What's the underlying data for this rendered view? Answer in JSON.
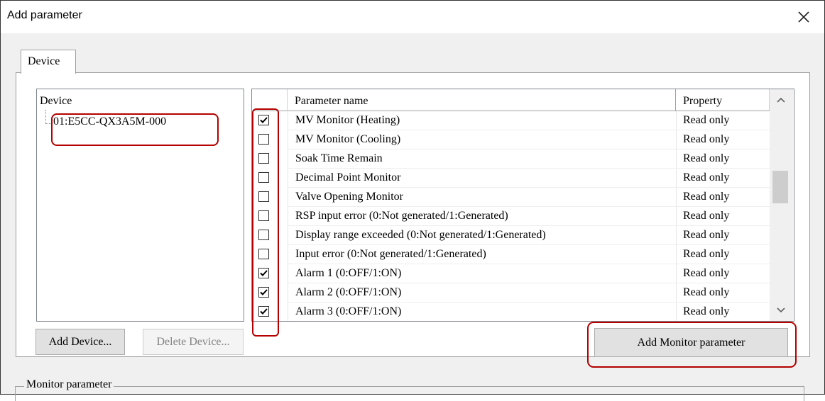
{
  "window": {
    "title": "Add parameter",
    "close_icon": "close-icon"
  },
  "tabs": [
    {
      "label": "Device"
    }
  ],
  "device_tree": {
    "header": "Device",
    "items": [
      {
        "label": "01:E5CC-QX3A5M-000"
      }
    ]
  },
  "buttons": {
    "add_device": "Add Device...",
    "delete_device": "Delete Device...",
    "add_monitor_parameter": "Add Monitor parameter"
  },
  "parameter_table": {
    "columns": [
      "",
      "Parameter name",
      "Property"
    ],
    "rows": [
      {
        "checked": true,
        "name": "MV Monitor (Heating)",
        "property": "Read only"
      },
      {
        "checked": false,
        "name": "MV Monitor (Cooling)",
        "property": "Read only"
      },
      {
        "checked": false,
        "name": "Soak Time Remain",
        "property": "Read only"
      },
      {
        "checked": false,
        "name": "Decimal Point Monitor",
        "property": "Read only"
      },
      {
        "checked": false,
        "name": "Valve Opening Monitor",
        "property": "Read only"
      },
      {
        "checked": false,
        "name": "RSP input error (0:Not generated/1:Generated)",
        "property": "Read only"
      },
      {
        "checked": false,
        "name": "Display range exceeded (0:Not generated/1:Generated)",
        "property": "Read only"
      },
      {
        "checked": false,
        "name": "Input error  (0:Not generated/1:Generated)",
        "property": "Read only"
      },
      {
        "checked": true,
        "name": "Alarm 1 (0:OFF/1:ON)",
        "property": "Read only"
      },
      {
        "checked": true,
        "name": "Alarm 2 (0:OFF/1:ON)",
        "property": "Read only"
      },
      {
        "checked": true,
        "name": "Alarm 3 (0:OFF/1:ON)",
        "property": "Read only"
      }
    ]
  },
  "monitor_group": {
    "label": "Monitor parameter"
  },
  "colors": {
    "highlight": "#b40000",
    "dialog_bg": "#f0f0f0"
  }
}
